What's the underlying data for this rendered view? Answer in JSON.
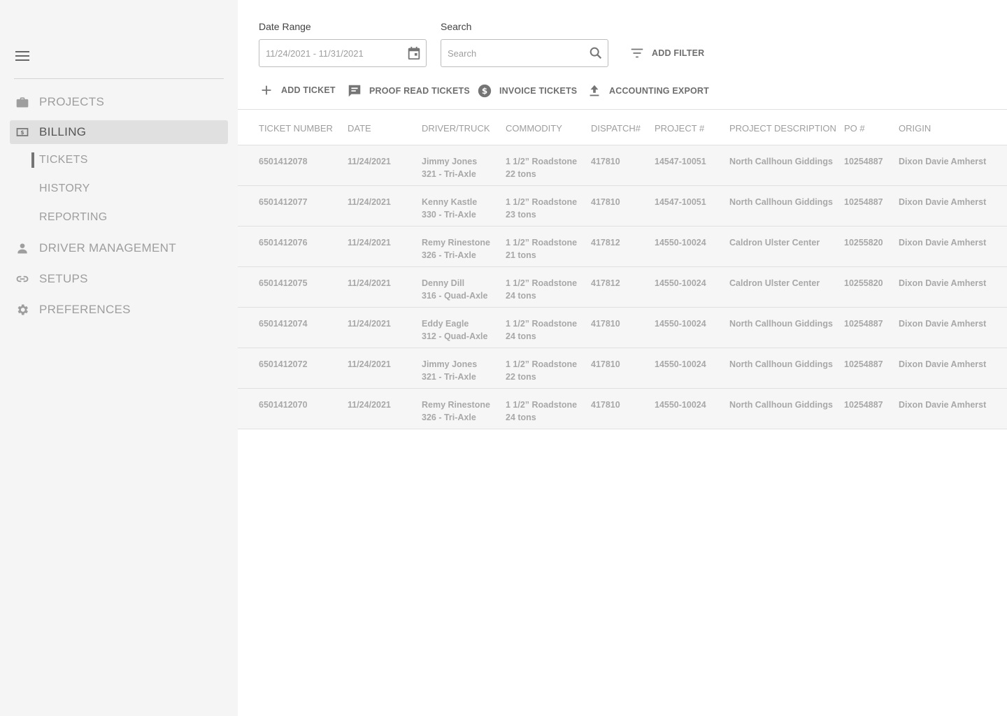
{
  "sidebar": {
    "items": [
      {
        "label": "PROJECTS",
        "icon": "briefcase-icon"
      },
      {
        "label": "BILLING",
        "icon": "money-icon"
      },
      {
        "label": "DRIVER MANAGEMENT",
        "icon": "person-icon"
      },
      {
        "label": "SETUPS",
        "icon": "link-icon"
      },
      {
        "label": "PREFERENCES",
        "icon": "gear-icon"
      }
    ],
    "billing_sub": [
      {
        "label": "TICKETS"
      },
      {
        "label": "HISTORY"
      },
      {
        "label": "REPORTING"
      }
    ]
  },
  "filters": {
    "date_range_label": "Date Range",
    "date_range_value": "11/24/2021 - 11/31/2021",
    "search_label": "Search",
    "search_placeholder": "Search",
    "add_filter": "ADD FILTER"
  },
  "actions": {
    "add_ticket": "ADD TICKET",
    "proof_read": "PROOF READ TICKETS",
    "invoice": "INVOICE TICKETS",
    "export": "ACCOUNTING EXPORT"
  },
  "table": {
    "columns": [
      "TICKET NUMBER",
      "DATE",
      "DRIVER/TRUCK",
      "COMMODITY",
      "DISPATCH#",
      "PROJECT #",
      "PROJECT DESCRIPTION",
      "PO #",
      "ORIGIN"
    ],
    "rows": [
      {
        "ticket": "6501412078",
        "date": "11/24/2021",
        "driver": "Jimmy Jones",
        "truck": "321 - Tri-Axle",
        "commodity": "1 1/2” Roadstone",
        "tons": "22 tons",
        "dispatch": "417810",
        "project": "14547-10051",
        "description": "North Callhoun Giddings",
        "po": "10254887",
        "origin": "Dixon Davie Amherst"
      },
      {
        "ticket": "6501412077",
        "date": "11/24/2021",
        "driver": "Kenny Kastle",
        "truck": "330 - Tri-Axle",
        "commodity": "1 1/2” Roadstone",
        "tons": "23 tons",
        "dispatch": "417810",
        "project": "14547-10051",
        "description": "North Callhoun Giddings",
        "po": "10254887",
        "origin": "Dixon Davie Amherst"
      },
      {
        "ticket": "6501412076",
        "date": "11/24/2021",
        "driver": "Remy Rinestone",
        "truck": "326 - Tri-Axle",
        "commodity": "1 1/2” Roadstone",
        "tons": "21 tons",
        "dispatch": "417812",
        "project": "14550-10024",
        "description": "Caldron Ulster Center",
        "po": "10255820",
        "origin": "Dixon Davie Amherst"
      },
      {
        "ticket": "6501412075",
        "date": "11/24/2021",
        "driver": "Denny Dill",
        "truck": "316 - Quad-Axle",
        "commodity": "1 1/2” Roadstone",
        "tons": "24 tons",
        "dispatch": "417812",
        "project": "14550-10024",
        "description": "Caldron Ulster Center",
        "po": "10255820",
        "origin": "Dixon Davie Amherst"
      },
      {
        "ticket": "6501412074",
        "date": "11/24/2021",
        "driver": "Eddy Eagle",
        "truck": "312 - Quad-Axle",
        "commodity": "1 1/2” Roadstone",
        "tons": "24 tons",
        "dispatch": "417810",
        "project": "14550-10024",
        "description": "North Callhoun Giddings",
        "po": "10254887",
        "origin": "Dixon Davie Amherst"
      },
      {
        "ticket": "6501412072",
        "date": "11/24/2021",
        "driver": "Jimmy Jones",
        "truck": "321 - Tri-Axle",
        "commodity": "1 1/2” Roadstone",
        "tons": "22 tons",
        "dispatch": "417810",
        "project": "14550-10024",
        "description": "North Callhoun Giddings",
        "po": "10254887",
        "origin": "Dixon Davie Amherst"
      },
      {
        "ticket": "6501412070",
        "date": "11/24/2021",
        "driver": "Remy Rinestone",
        "truck": "326 - Tri-Axle",
        "commodity": "1 1/2” Roadstone",
        "tons": "24 tons",
        "dispatch": "417810",
        "project": "14550-10024",
        "description": "North Callhoun Giddings",
        "po": "10254887",
        "origin": "Dixon Davie Amherst"
      }
    ]
  }
}
